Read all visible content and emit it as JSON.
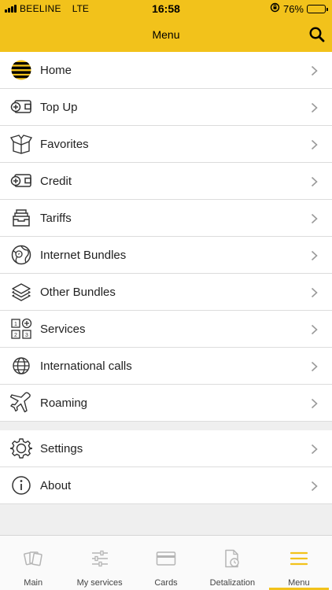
{
  "status_bar": {
    "carrier": "BEELINE",
    "network": "LTE",
    "time": "16:58",
    "battery": "76%",
    "battery_level": 0.76
  },
  "header": {
    "title": "Menu",
    "search_icon": "search-icon"
  },
  "menu": {
    "items": [
      {
        "label": "Home",
        "icon": "beeline-logo-icon"
      },
      {
        "label": "Top Up",
        "icon": "wallet-plus-icon"
      },
      {
        "label": "Favorites",
        "icon": "gift-box-icon"
      },
      {
        "label": "Credit",
        "icon": "wallet-plus-icon"
      },
      {
        "label": "Tariffs",
        "icon": "tray-icon"
      },
      {
        "label": "Internet Bundles",
        "icon": "globe-network-icon"
      },
      {
        "label": "Other Bundles",
        "icon": "layers-icon"
      },
      {
        "label": "Services",
        "icon": "services-grid-icon"
      },
      {
        "label": "International calls",
        "icon": "globe-icon"
      },
      {
        "label": "Roaming",
        "icon": "airplane-icon"
      }
    ],
    "secondary": [
      {
        "label": "Settings",
        "icon": "gear-icon"
      },
      {
        "label": "About",
        "icon": "info-icon"
      }
    ]
  },
  "tab_bar": {
    "tabs": [
      {
        "label": "Main",
        "icon": "cards-icon"
      },
      {
        "label": "My services",
        "icon": "sliders-icon"
      },
      {
        "label": "Cards",
        "icon": "credit-card-icon"
      },
      {
        "label": "Detalization",
        "icon": "document-clock-icon"
      },
      {
        "label": "Menu",
        "icon": "hamburger-icon"
      }
    ],
    "active": "Menu"
  },
  "colors": {
    "accent": "#f2c21b",
    "background": "#efefef",
    "row_background": "#ffffff"
  }
}
